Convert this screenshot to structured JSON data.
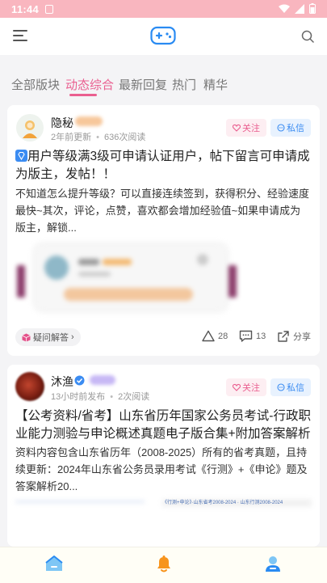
{
  "status": {
    "time": "11:44"
  },
  "tabs": [
    {
      "label": "全部版块",
      "active": false
    },
    {
      "label": "动态综合",
      "active": true
    },
    {
      "label": "最新回复",
      "active": false
    },
    {
      "label": "热门",
      "active": false
    },
    {
      "label": "精华",
      "active": false
    }
  ],
  "posts": [
    {
      "author": "隐秘",
      "meta_time": "2年前更新",
      "meta_reads": "636次阅读",
      "follow_label": "关注",
      "message_label": "私信",
      "title": "用户等级满3级可申请认证用户，帖下留言可申请成为版主，发帖！！",
      "excerpt": "不知道怎么提升等级？可以直接连续签到，获得积分、经验速度最快~其次，评论，点赞，喜欢都会增加经验值~如果申请成为版主，解锁...",
      "topic": "疑问解答",
      "likes": "28",
      "comments": "13",
      "share_label": "分享"
    },
    {
      "author": "沐渔",
      "meta_time": "13小时前发布",
      "meta_reads": "2次阅读",
      "follow_label": "关注",
      "message_label": "私信",
      "title": "【公考资料/省考】山东省历年国家公务员考试-行政职业能力测验与申论概述真题电子版合集+附加答案解析",
      "excerpt": "资料内容包含山东省历年（2008-2025）所有的省考真题，且持续更新：2024年山东省公务员录用考试《行测》+《申论》题及答案解析20...",
      "preview_text": "《行测+申论》·山东省考2008-2024 · 山东行测2008-2024"
    }
  ],
  "colors": {
    "accent": "#ea5f90",
    "status_bar": "#f9b6bf",
    "blue": "#3b8cf2"
  }
}
